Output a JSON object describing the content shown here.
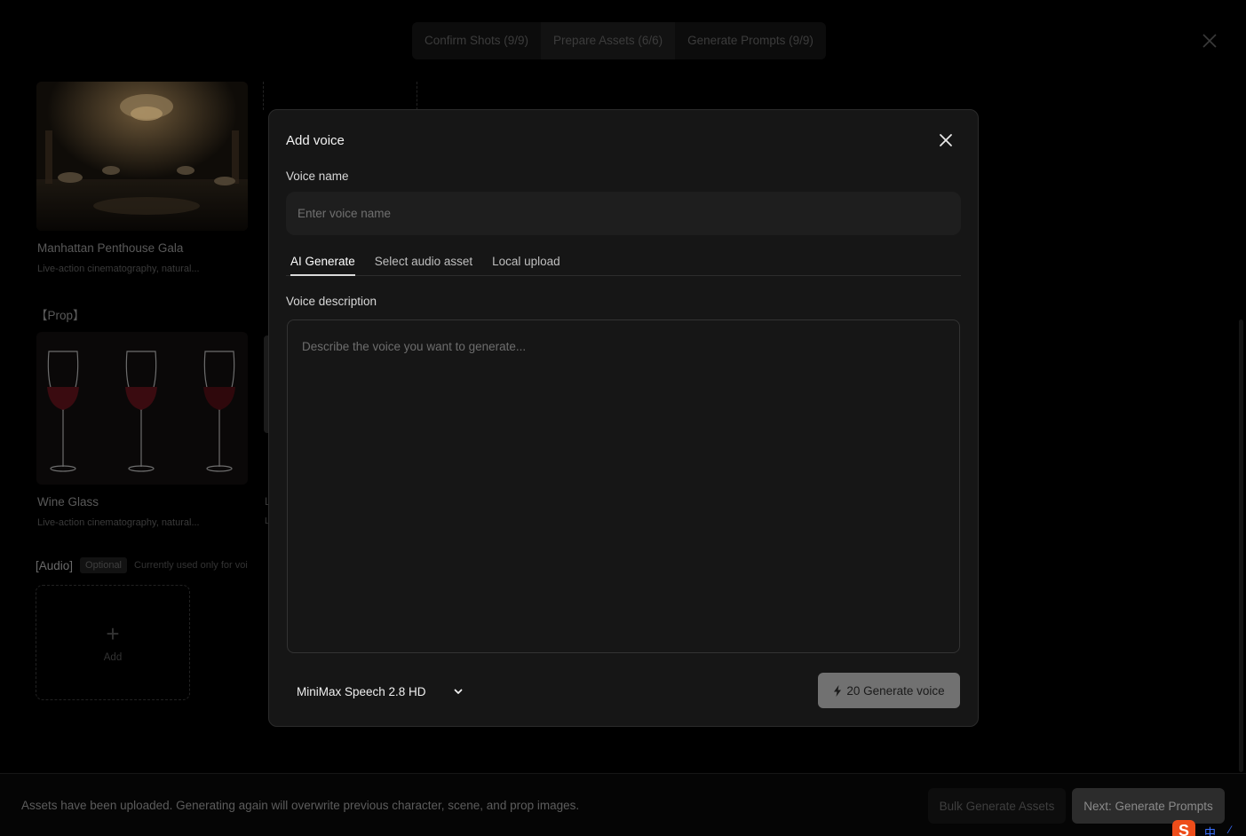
{
  "steps": [
    {
      "label": "Confirm Shots (9/9)"
    },
    {
      "label": "Prepare Assets (6/6)"
    },
    {
      "label": "Generate Prompts (9/9)"
    }
  ],
  "background": {
    "scene_card": {
      "title": "Manhattan Penthouse Gala",
      "description": "Live-action cinematography, natural..."
    },
    "prop_section_label": "【Prop】",
    "prop_card": {
      "title": "Wine Glass",
      "description": "Live-action cinematography, natural..."
    },
    "neighbor_card": {
      "title_initial": "L",
      "desc_initial": "L"
    },
    "audio": {
      "label": "[Audio]",
      "badge": "Optional",
      "note": "Currently used only for voi"
    },
    "add_label": "Add"
  },
  "footer": {
    "note": "Assets have been uploaded. Generating again will overwrite previous character, scene, and prop images.",
    "bulk_button": "Bulk Generate Assets",
    "next_button": "Next: Generate Prompts"
  },
  "ime": {
    "logo": "S",
    "mode": "中",
    "extra": "⁄"
  },
  "modal": {
    "title": "Add voice",
    "voice_name_label": "Voice name",
    "voice_name_placeholder": "Enter voice name",
    "voice_name_value": "",
    "tabs": [
      {
        "label": "AI Generate",
        "active": true
      },
      {
        "label": "Select audio asset",
        "active": false
      },
      {
        "label": "Local upload",
        "active": false
      }
    ],
    "description_label": "Voice description",
    "description_placeholder": "Describe the voice you want to generate...",
    "model": "MiniMax Speech 2.8 HD",
    "generate_button": "20 Generate voice"
  },
  "colors": {
    "background": "#000000",
    "modal_bg": "#161616",
    "input_bg": "#1e1e1e",
    "generate_button_bg": "#717171"
  }
}
